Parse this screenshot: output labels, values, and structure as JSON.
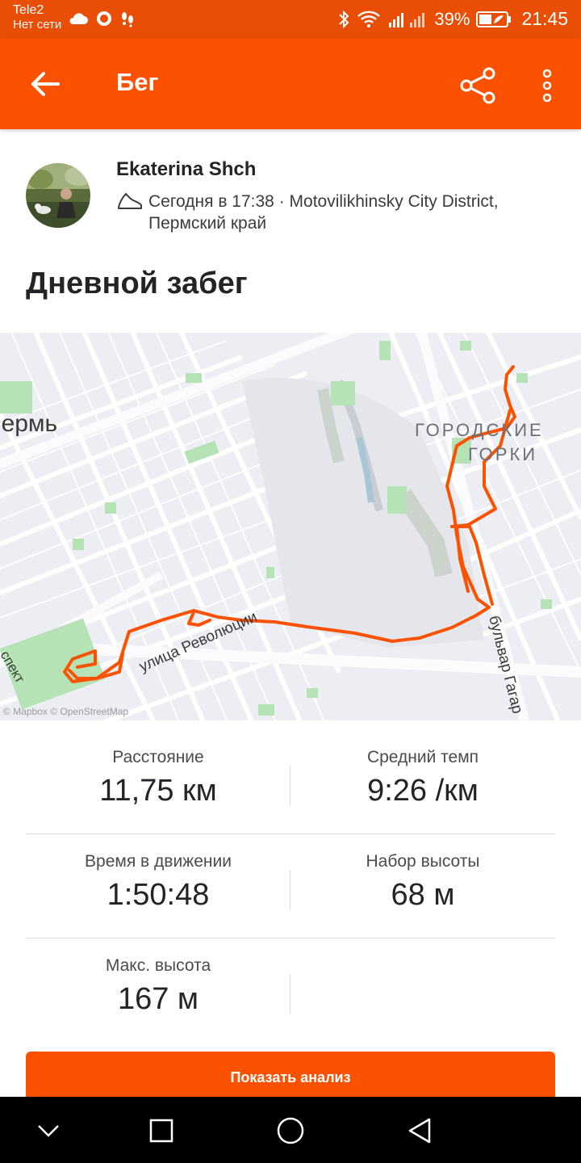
{
  "status_bar": {
    "carrier": "Tele2",
    "network_status": "Нет сети",
    "battery_percent": "39%",
    "time": "21:45"
  },
  "app_bar": {
    "title": "Бег",
    "back_icon": "arrow-left-icon",
    "share_icon": "share-icon",
    "more_icon": "more-vertical-icon"
  },
  "athlete": {
    "name": "Ekaterina Shch",
    "meta": "Сегодня в 17:38 · Motovilikhinsky City District, Пермский край"
  },
  "activity": {
    "title": "Дневной забег"
  },
  "map": {
    "labels": {
      "city": "Пермь",
      "district_line1": "ГОРОДСКИЕ",
      "district_line2": "ГОРКИ",
      "street1": "улица Революции",
      "street2": "бульвар Гагар",
      "street3": "спект"
    },
    "attribution": "© Mapbox © OpenStreetMap",
    "route_color": "#fc5200"
  },
  "stats": [
    {
      "label": "Расстояние",
      "value": "11,75 км"
    },
    {
      "label": "Средний темп",
      "value": "9:26 /км"
    },
    {
      "label": "Время в движении",
      "value": "1:50:48"
    },
    {
      "label": "Набор высоты",
      "value": "68 м"
    },
    {
      "label": "Макс. высота",
      "value": "167 м"
    }
  ],
  "analysis_button": "Показать анализ",
  "colors": {
    "brand_orange": "#fc5200",
    "status_bar": "#e84e06"
  }
}
